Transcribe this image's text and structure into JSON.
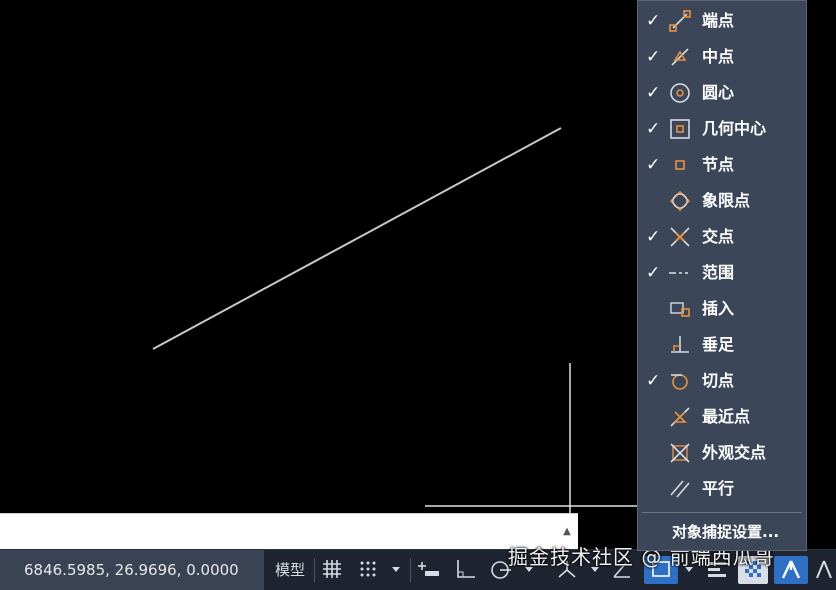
{
  "command_line": {
    "value": "",
    "placeholder": "",
    "history_arrow": "▲"
  },
  "status_bar": {
    "coordinates": "6846.5985, 26.9696, 0.0000",
    "model_label": "模型",
    "icons": [
      "grid-icon",
      "snap-icon",
      "dropdown-icon",
      "infer-constraints-icon",
      "ortho-icon",
      "polar-icon",
      "object-snap-tracking-icon",
      "object-snap-icon",
      "lineweight-icon",
      "transparency-icon",
      "annotation-scale-icon"
    ]
  },
  "watermark": "掘金技术社区 @ 前端西瓜哥",
  "osnap_menu": {
    "items": [
      {
        "label": "端点",
        "checked": true,
        "icon": "endpoint-icon"
      },
      {
        "label": "中点",
        "checked": true,
        "icon": "midpoint-icon"
      },
      {
        "label": "圆心",
        "checked": true,
        "icon": "center-icon"
      },
      {
        "label": "几何中心",
        "checked": true,
        "icon": "geometric-center-icon"
      },
      {
        "label": "节点",
        "checked": true,
        "icon": "node-icon"
      },
      {
        "label": "象限点",
        "checked": false,
        "icon": "quadrant-icon"
      },
      {
        "label": "交点",
        "checked": true,
        "icon": "intersection-icon"
      },
      {
        "label": "范围",
        "checked": true,
        "icon": "extension-icon"
      },
      {
        "label": "插入",
        "checked": false,
        "icon": "insertion-icon"
      },
      {
        "label": "垂足",
        "checked": false,
        "icon": "perpendicular-icon"
      },
      {
        "label": "切点",
        "checked": true,
        "icon": "tangent-icon"
      },
      {
        "label": "最近点",
        "checked": false,
        "icon": "nearest-icon"
      },
      {
        "label": "外观交点",
        "checked": false,
        "icon": "apparent-intersection-icon"
      },
      {
        "label": "平行",
        "checked": false,
        "icon": "parallel-icon"
      }
    ],
    "settings_label": "对象捕捉设置...",
    "check_mark": "✓"
  },
  "colors": {
    "canvas": "#000000",
    "menu_bg": "#3b4658",
    "snap_icon": "#e8913c",
    "status_bg": "#1f2530"
  }
}
